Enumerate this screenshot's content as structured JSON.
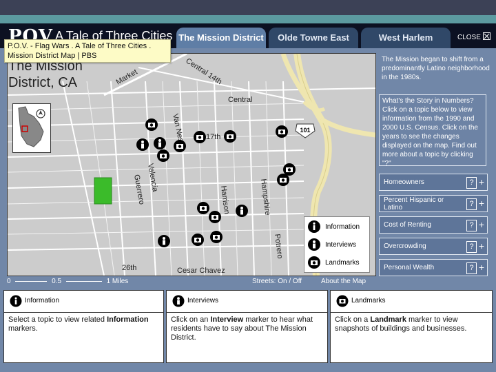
{
  "app": {
    "logo": "POV",
    "title": "A Tale of Three Cities",
    "tooltip_line1": "P.O.V. - Flag Wars . A Tale of Three Cities .",
    "tooltip_line2": "Mission District Map | PBS",
    "close_label": "CLOSE"
  },
  "tabs": [
    {
      "label": "The Mission District",
      "active": true
    },
    {
      "label": "Olde Towne East",
      "active": false
    },
    {
      "label": "West Harlem",
      "active": false
    }
  ],
  "map": {
    "title_line1": "The Mission",
    "title_line2": "District, CA",
    "streets": [
      "Market",
      "Central 14th",
      "Central",
      "Van Ness",
      "17th",
      "Valencia",
      "Guerrero",
      "Harrison",
      "Hampshire",
      "Potrero",
      "26th",
      "Cesar Chavez"
    ],
    "highway_label": "101",
    "legend": [
      {
        "label": "Information",
        "icon": "info-icon"
      },
      {
        "label": "Interviews",
        "icon": "person-icon"
      },
      {
        "label": "Landmarks",
        "icon": "camera-icon"
      }
    ],
    "scale": {
      "zero": "0",
      "half": "0.5",
      "one": "1 Miles"
    },
    "streets_toggle": "Streets: On / Off",
    "about_link": "About the Map"
  },
  "sidebar": {
    "intro": "The Mission began to shift from a predominantly Latino neighborhood in the 1980s.",
    "story_box": "What's the Story in Numbers? Click on a topic below to view information from the 1990 and 2000 U.S. Census. Click on the years to see the changes displayed on the map. Find out more about a topic by clicking \"?\"",
    "topics": [
      {
        "label": "Homeowners"
      },
      {
        "label": "Percent Hispanic or Latino"
      },
      {
        "label": "Cost of Renting"
      },
      {
        "label": "Overcrowding"
      },
      {
        "label": "Personal Wealth"
      }
    ],
    "help_label": "?",
    "expand_label": "+"
  },
  "panels": [
    {
      "title": "Information",
      "icon": "info-icon",
      "pre": "Select a topic to view related ",
      "bold": "Information",
      "post": " markers."
    },
    {
      "title": "Interviews",
      "icon": "person-icon",
      "pre": "Click on an ",
      "bold": "Interview",
      "post": " marker to hear what residents have to say about The Mission District."
    },
    {
      "title": "Landmarks",
      "icon": "camera-icon",
      "pre": "Click on a ",
      "bold": "Landmark",
      "post": " marker to view snapshots of buildings and businesses."
    }
  ],
  "colors": {
    "header": "#0c1122",
    "app_bg": "#7187a8",
    "active_tab": "#5f7ea6",
    "inactive_tab": "#304868",
    "map_bg": "#cccccc",
    "highway": "#efe6b0",
    "park": "#3bbb2a",
    "tooltip": "#fdfbc6"
  }
}
